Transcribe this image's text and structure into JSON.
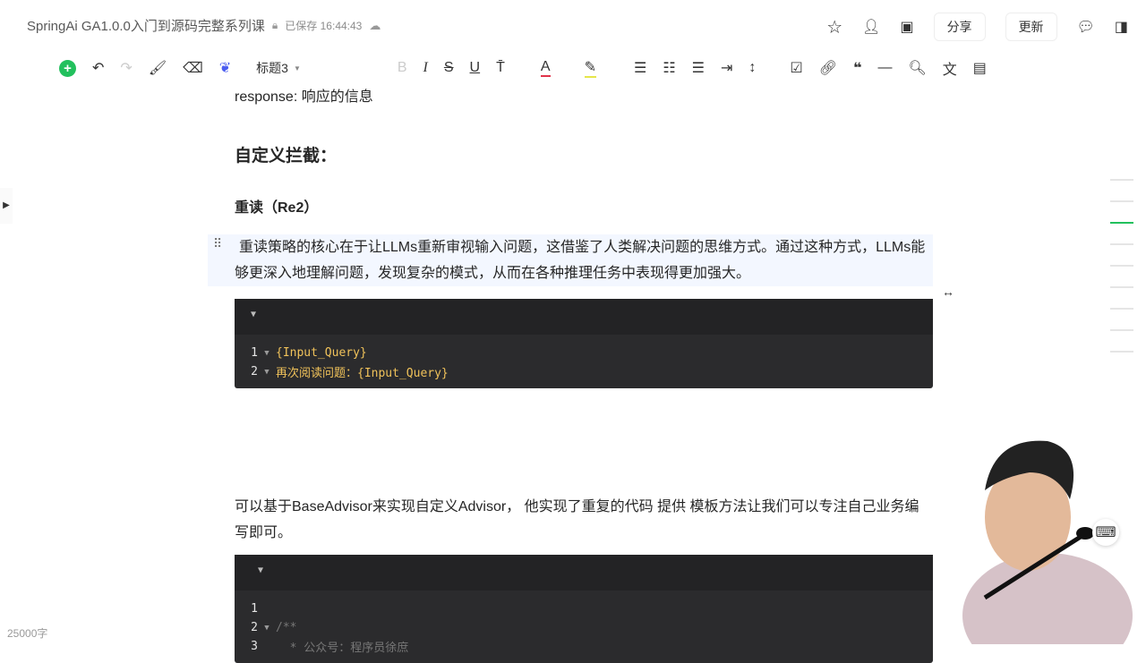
{
  "header": {
    "title": "SpringAi GA1.0.0入门到源码完整系列课",
    "saved": "已保存 16:44:43",
    "share": "分享",
    "update": "更新"
  },
  "toolbar": {
    "heading_style": "标题3"
  },
  "doc": {
    "p1": "response: 响应的信息",
    "h_custom": "自定义拦截：",
    "h_re2": "重读（Re2）",
    "p_re2": "重读策略的核心在于让LLMs重新审视输入问题，这借鉴了人类解决问题的思维方式。通过这种方式，LLMs能够更深入地理解问题，发现复杂的模式，从而在各种推理任务中表现得更加强大。",
    "code1": [
      {
        "n": "1",
        "text": "{Input_Query}"
      },
      {
        "n": "2",
        "text": "再次阅读问题：{Input_Query}"
      }
    ],
    "p_advisor": "可以基于BaseAdvisor来实现自定义Advisor， 他实现了重复的代码 提供 模板方法让我们可以专注自己业务编写即可。",
    "code2": [
      {
        "n": "1",
        "text": ""
      },
      {
        "n": "2",
        "text": "/**"
      },
      {
        "n": "3",
        "text": "  * 公众号：程序员徐庶"
      }
    ]
  },
  "footer": {
    "word_count": "25000字"
  }
}
